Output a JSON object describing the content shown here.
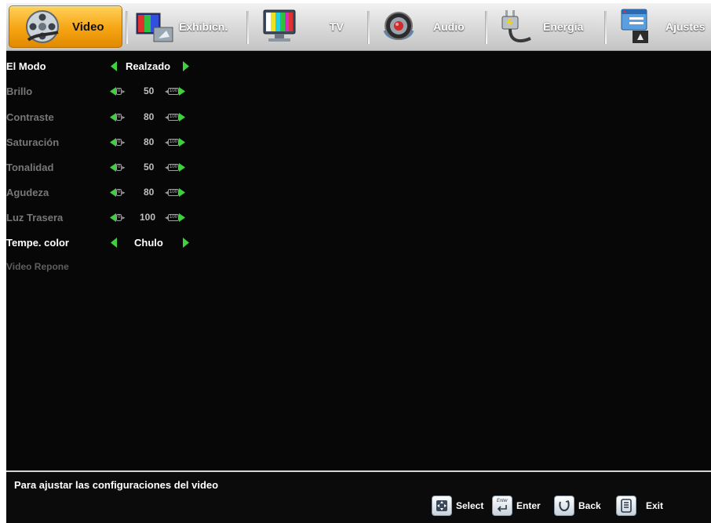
{
  "tabs": [
    {
      "label": "Video",
      "icon": "film-reel-icon",
      "active": true
    },
    {
      "label": "Exhibicn.",
      "icon": "color-bars-display-icon",
      "active": false
    },
    {
      "label": "TV",
      "icon": "tv-monitor-icon",
      "active": false
    },
    {
      "label": "Audio",
      "icon": "speaker-icon",
      "active": false
    },
    {
      "label": "Energía",
      "icon": "power-plug-icon",
      "active": false
    },
    {
      "label": "Ajustes",
      "icon": "settings-window-icon",
      "active": false
    }
  ],
  "settings": [
    {
      "label": "El Modo",
      "value": "Realzado",
      "type": "option",
      "highlight": true
    },
    {
      "label": "Brillo",
      "value": "50",
      "type": "slider",
      "min": "0",
      "max": "100"
    },
    {
      "label": "Contraste",
      "value": "80",
      "type": "slider",
      "min": "0",
      "max": "100"
    },
    {
      "label": "Saturación",
      "value": "80",
      "type": "slider",
      "min": "0",
      "max": "100"
    },
    {
      "label": "Tonalidad",
      "value": "50",
      "type": "slider",
      "min": "0",
      "max": "100"
    },
    {
      "label": "Agudeza",
      "value": "80",
      "type": "slider",
      "min": "0",
      "max": "100"
    },
    {
      "label": "Luz Trasera",
      "value": "100",
      "type": "slider",
      "min": "0",
      "max": "100"
    },
    {
      "label": "Tempe. color",
      "value": "Chulo",
      "type": "option",
      "highlight": true
    },
    {
      "label": "Video Repone",
      "type": "action"
    }
  ],
  "help_text": "Para ajustar las configuraciones del video",
  "keys": [
    {
      "label": "Select",
      "icon": "dpad-icon"
    },
    {
      "label": "Enter",
      "icon": "enter-key-icon",
      "key_text": "Enter"
    },
    {
      "label": "Back",
      "icon": "back-arrow-icon"
    },
    {
      "label": "Exit",
      "icon": "exit-menu-icon"
    }
  ],
  "colors": {
    "active_tab": "#f6a413",
    "arrow": "#3fd13f",
    "background": "#070707"
  }
}
